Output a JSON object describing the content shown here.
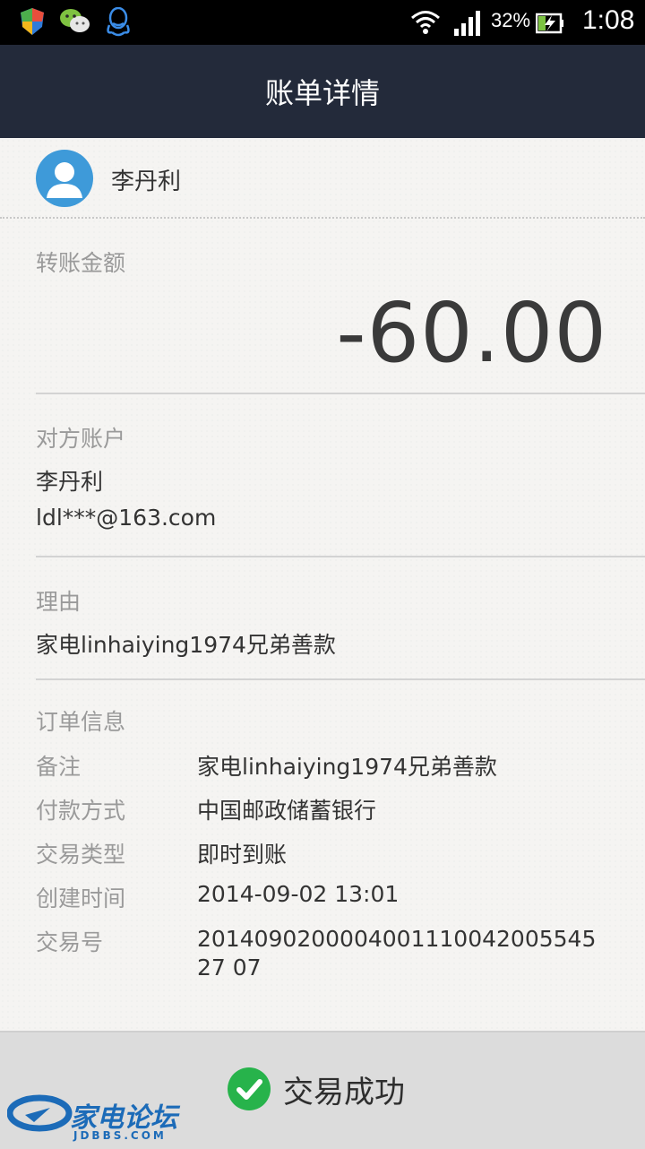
{
  "status_bar": {
    "battery_percent": "32%",
    "time": "1:08",
    "icons": [
      "shield-icon",
      "wechat-icon",
      "qq-icon",
      "wifi-icon",
      "signal-icon",
      "battery-icon"
    ]
  },
  "header": {
    "title": "账单详情"
  },
  "payee": {
    "name": "李丹利"
  },
  "amount": {
    "label": "转账金额",
    "value": "-60.00"
  },
  "counterparty": {
    "label": "对方账户",
    "name": "李丹利",
    "email": "ldl***@163.com"
  },
  "reason": {
    "label": "理由",
    "value": "家电linhaiying1974兄弟善款"
  },
  "order_info": {
    "label": "订单信息",
    "rows": [
      {
        "label": "备注",
        "value": "家电linhaiying1974兄弟善款"
      },
      {
        "label": "付款方式",
        "value": "中国邮政储蓄银行"
      },
      {
        "label": "交易类型",
        "value": "即时到账"
      },
      {
        "label": "创建时间",
        "value": "2014-09-02 13:01"
      },
      {
        "label": "交易号",
        "value": "201409020000400111004200554527 07"
      }
    ]
  },
  "status": {
    "text": "交易成功",
    "color": "#27b34b"
  },
  "watermark": {
    "text": "家电论坛",
    "sub": "JDBBS.COM"
  }
}
